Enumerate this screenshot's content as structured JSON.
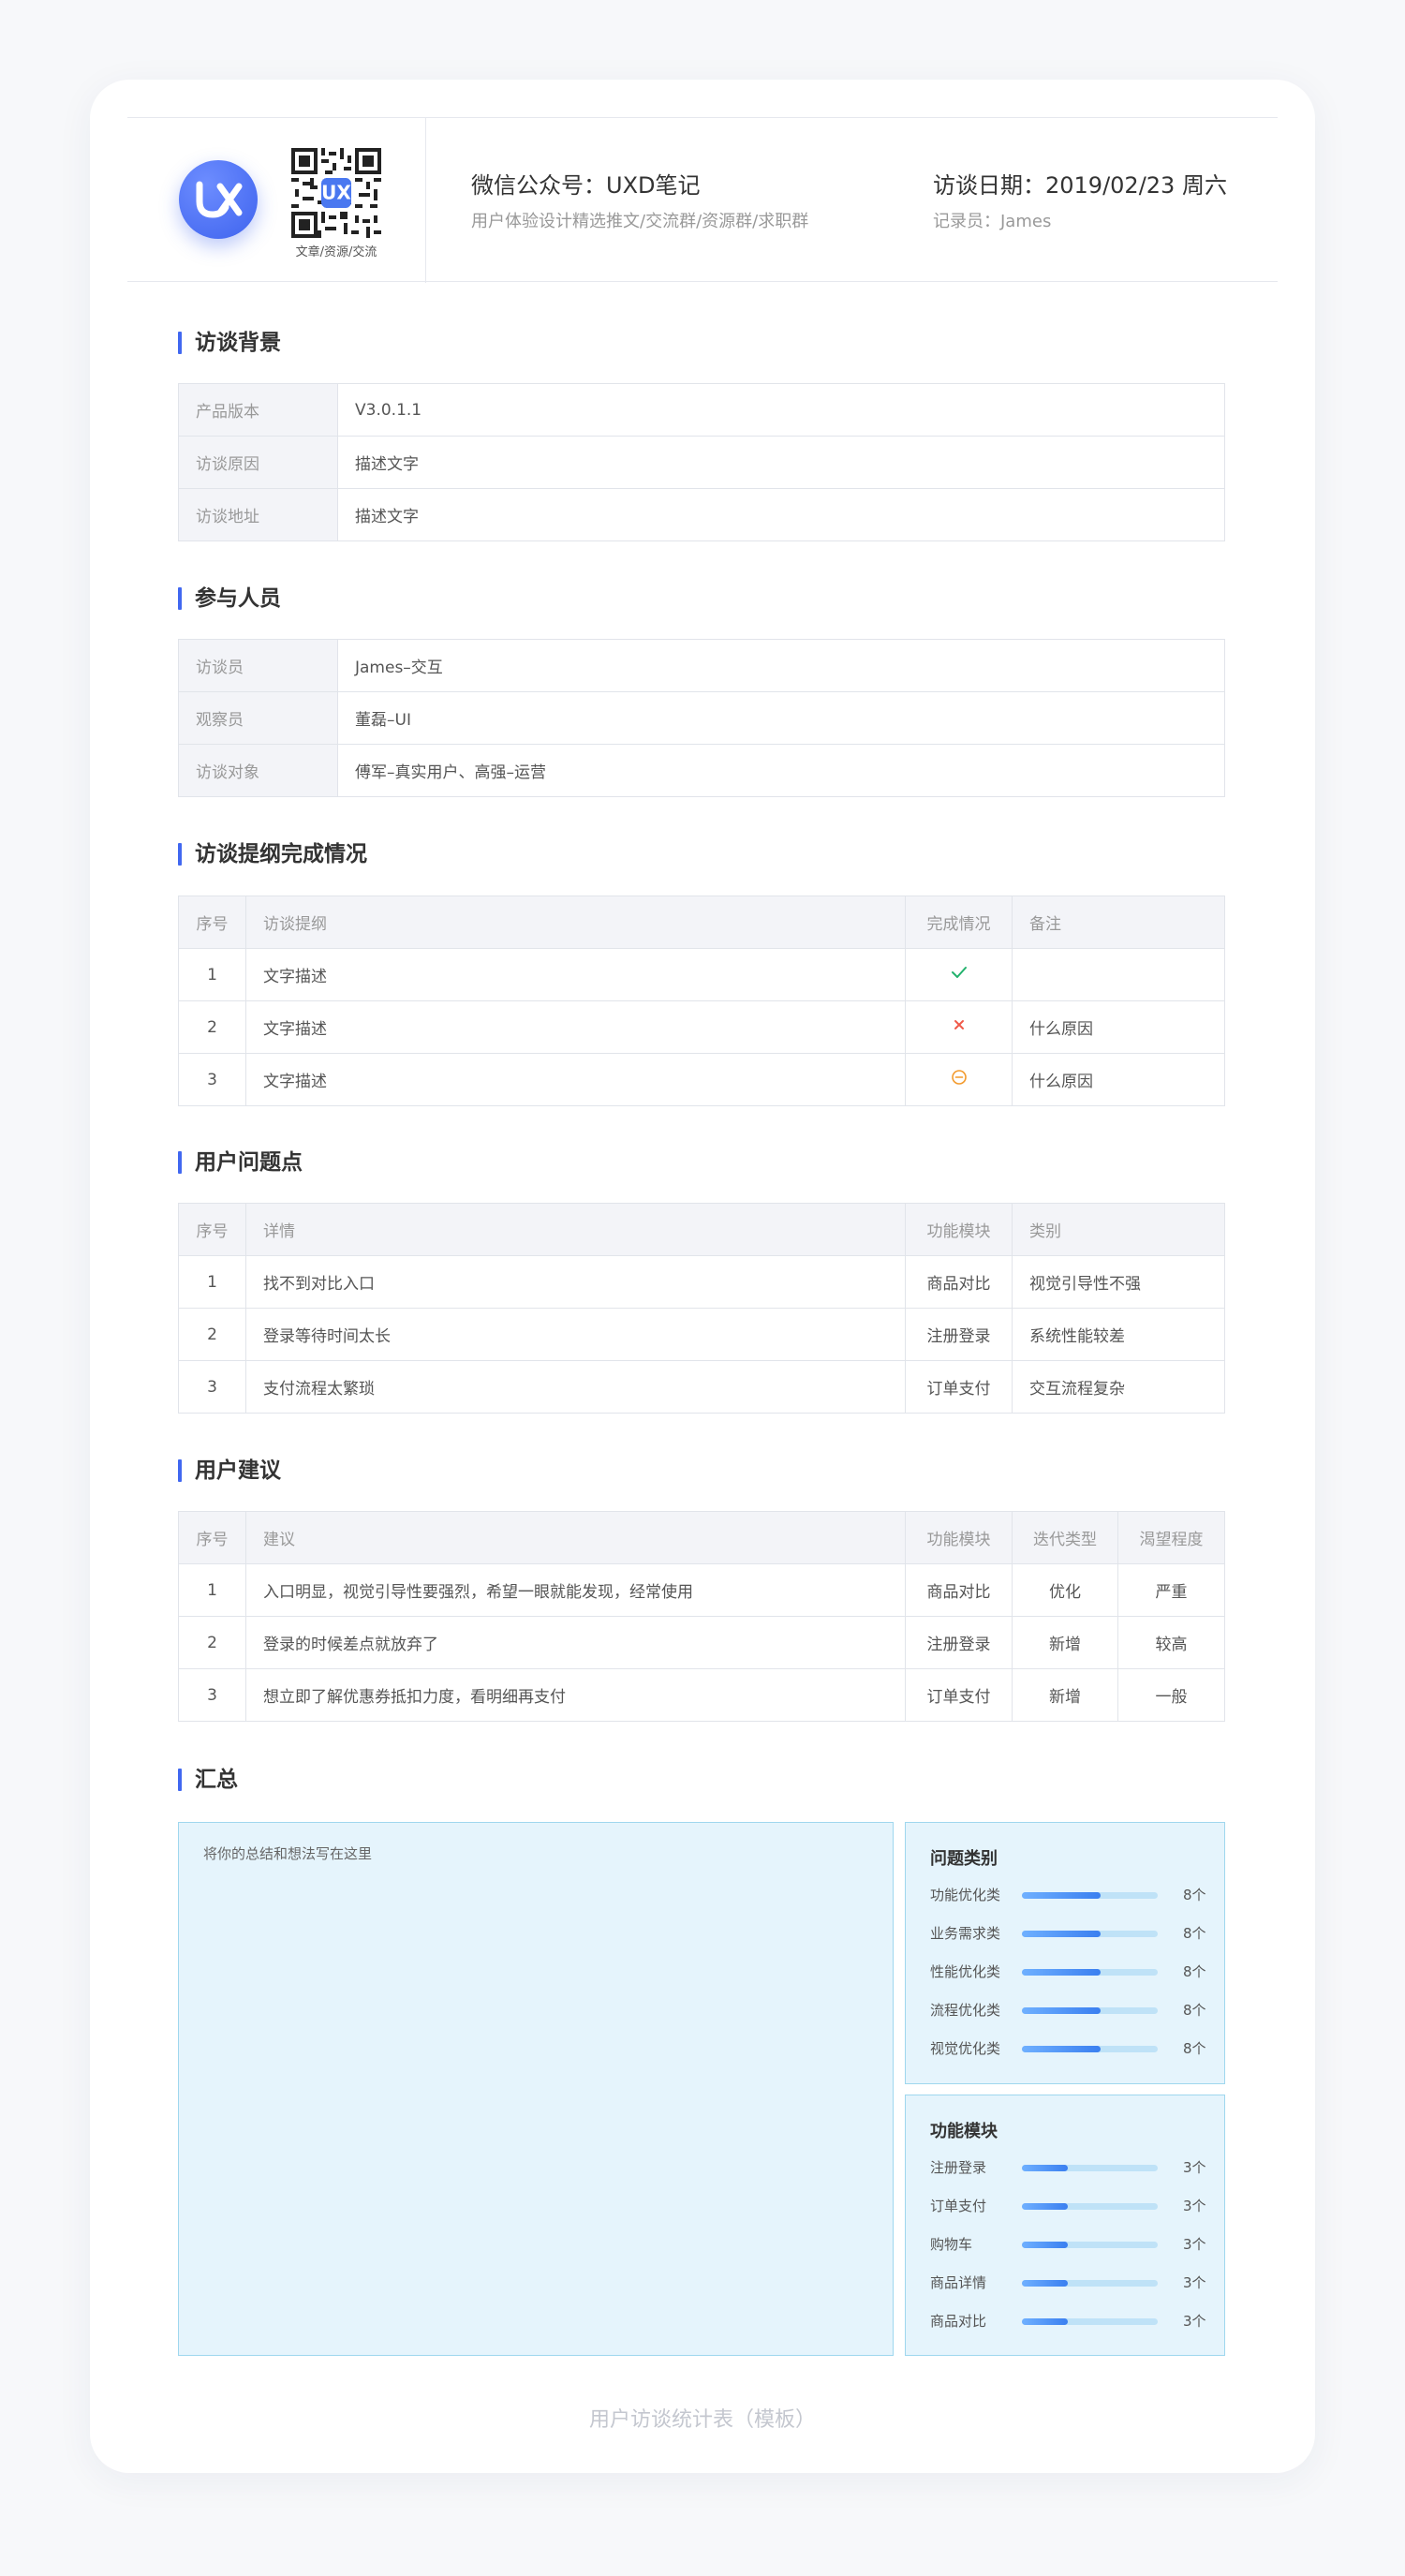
{
  "header": {
    "qr_caption": "文章/资源/交流",
    "pub_title": "微信公众号：UXD笔记",
    "pub_subtitle": "用户体验设计精选推文/交流群/资源群/求职群",
    "date_title": "访谈日期：2019/02/23 周六",
    "recorder": "记录员：James"
  },
  "background": {
    "title": "访谈背景",
    "rows": [
      {
        "key": "产品版本",
        "value": "V3.0.1.1"
      },
      {
        "key": "访谈原因",
        "value": "描述文字"
      },
      {
        "key": "访谈地址",
        "value": "描述文字"
      }
    ]
  },
  "participants": {
    "title": "参与人员",
    "rows": [
      {
        "key": "访谈员",
        "value": "James–交互"
      },
      {
        "key": "观察员",
        "value": "董磊–UI"
      },
      {
        "key": "访谈对象",
        "value": "傅军–真实用户、高强–运营"
      }
    ]
  },
  "outline": {
    "title": "访谈提纲完成情况",
    "headers": [
      "序号",
      "访谈提纲",
      "完成情况",
      "备注"
    ],
    "rows": [
      {
        "no": "1",
        "item": "文字描述",
        "status": "done",
        "note": ""
      },
      {
        "no": "2",
        "item": "文字描述",
        "status": "failed",
        "note": "什么原因"
      },
      {
        "no": "3",
        "item": "文字描述",
        "status": "partial",
        "note": "什么原因"
      }
    ],
    "status_colors": {
      "done": "#23b26d",
      "failed": "#f05a4a",
      "partial": "#f39a2c"
    }
  },
  "problems": {
    "title": "用户问题点",
    "headers": [
      "序号",
      "详情",
      "功能模块",
      "类别"
    ],
    "rows": [
      {
        "no": "1",
        "detail": "找不到对比入口",
        "module": "商品对比",
        "category": "视觉引导性不强"
      },
      {
        "no": "2",
        "detail": "登录等待时间太长",
        "module": "注册登录",
        "category": "系统性能较差"
      },
      {
        "no": "3",
        "detail": "支付流程太繁琐",
        "module": "订单支付",
        "category": "交互流程复杂"
      }
    ]
  },
  "suggestions": {
    "title": "用户建议",
    "headers": [
      "序号",
      "建议",
      "功能模块",
      "迭代类型",
      "渴望程度"
    ],
    "rows": [
      {
        "no": "1",
        "text": "入口明显，视觉引导性要强烈，希望一眼就能发现，经常使用",
        "module": "商品对比",
        "type": "优化",
        "desire": "严重"
      },
      {
        "no": "2",
        "text": "登录的时候差点就放弃了",
        "module": "注册登录",
        "type": "新增",
        "desire": "较高"
      },
      {
        "no": "3",
        "text": "想立即了解优惠券抵扣力度，看明细再支付",
        "module": "订单支付",
        "type": "新增",
        "desire": "一般"
      }
    ]
  },
  "summary": {
    "title": "汇总",
    "placeholder": "将你的总结和想法写在这里",
    "problem_types": {
      "title": "问题类别",
      "items": [
        {
          "label": "功能优化类",
          "value": "8个",
          "level": 0.58
        },
        {
          "label": "业务需求类",
          "value": "8个",
          "level": 0.58
        },
        {
          "label": "性能优化类",
          "value": "8个",
          "level": 0.58
        },
        {
          "label": "流程优化类",
          "value": "8个",
          "level": 0.58
        },
        {
          "label": "视觉优化类",
          "value": "8个",
          "level": 0.58
        }
      ]
    },
    "modules": {
      "title": "功能模块",
      "items": [
        {
          "label": "注册登录",
          "value": "3个",
          "level": 0.34
        },
        {
          "label": "订单支付",
          "value": "3个",
          "level": 0.34
        },
        {
          "label": "购物车",
          "value": "3个",
          "level": 0.34
        },
        {
          "label": "商品详情",
          "value": "3个",
          "level": 0.34
        },
        {
          "label": "商品对比",
          "value": "3个",
          "level": 0.34
        }
      ]
    }
  },
  "footer": "用户访谈统计表（模板）"
}
